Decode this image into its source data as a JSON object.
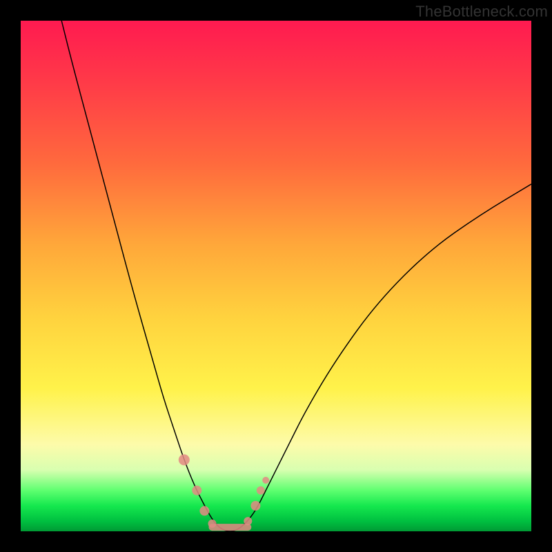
{
  "watermark": "TheBottleneck.com",
  "colors": {
    "gradient_top": "#ff1a50",
    "gradient_mid": "#ffd23e",
    "gradient_bottom": "#009a34",
    "curve_stroke": "#000000",
    "marker": "#e38a84",
    "frame": "#000000"
  },
  "chart_data": {
    "type": "line",
    "title": "",
    "xlabel": "",
    "ylabel": "",
    "xlim": [
      0,
      100
    ],
    "ylim": [
      0,
      100
    ],
    "grid": false,
    "legend": false,
    "note": "Bottleneck-style V-curve. Background vertical gradient maps y≈0 (bottom) → green (good) up to y≈100 (top) → red (bad). Curve minimum ≈ 0 at x≈40. Axes have no visible tick labels; x/y are normalized 0–100 against the inner plot area.",
    "series": [
      {
        "name": "bottleneck-curve",
        "x": [
          8,
          10,
          14,
          18,
          22,
          26,
          28,
          30,
          32,
          34,
          36,
          38,
          40,
          42,
          44,
          46,
          48,
          52,
          56,
          62,
          70,
          80,
          90,
          100
        ],
        "y": [
          100,
          92,
          77,
          62,
          47,
          33,
          26,
          20,
          14,
          9,
          5,
          1.5,
          0,
          0,
          1.5,
          4,
          8,
          16,
          24,
          34,
          45,
          55,
          62,
          68
        ]
      }
    ],
    "markers": [
      {
        "x": 32.0,
        "y": 14.0,
        "r": 8
      },
      {
        "x": 34.5,
        "y": 8.0,
        "r": 7
      },
      {
        "x": 36.0,
        "y": 4.0,
        "r": 7
      },
      {
        "x": 37.5,
        "y": 1.5,
        "r": 6
      },
      {
        "x": 44.5,
        "y": 2.0,
        "r": 6
      },
      {
        "x": 46.0,
        "y": 5.0,
        "r": 7
      },
      {
        "x": 47.0,
        "y": 8.0,
        "r": 6
      },
      {
        "x": 48.0,
        "y": 10.0,
        "r": 5
      }
    ],
    "flat_segment": {
      "x0": 37.5,
      "x1": 44.5,
      "y": 0.8
    }
  }
}
